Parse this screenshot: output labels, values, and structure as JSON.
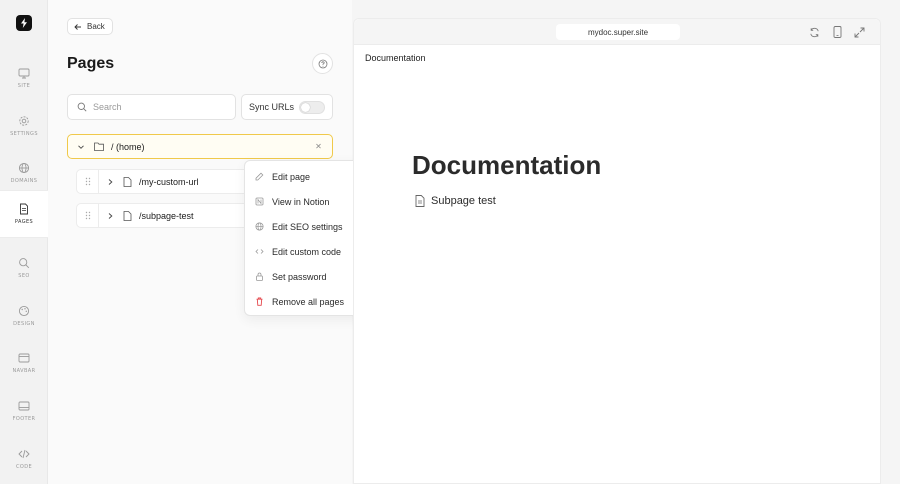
{
  "sidebar": {
    "items": [
      {
        "label": "SITE",
        "icon": "monitor-icon"
      },
      {
        "label": "SETTINGS",
        "icon": "gear-icon"
      },
      {
        "label": "DOMAINS",
        "icon": "globe-icon"
      },
      {
        "label": "PAGES",
        "icon": "page-icon"
      },
      {
        "label": "SEO",
        "icon": "search-icon"
      },
      {
        "label": "DESIGN",
        "icon": "palette-icon"
      },
      {
        "label": "NAVBAR",
        "icon": "navbar-icon"
      },
      {
        "label": "FOOTER",
        "icon": "footer-icon"
      },
      {
        "label": "CODE",
        "icon": "code-icon"
      }
    ],
    "active": "PAGES"
  },
  "main": {
    "back_label": "Back",
    "title": "Pages",
    "search_placeholder": "Search",
    "sync_label": "Sync URLs",
    "sync_enabled": false,
    "tree": {
      "home": "/ (home)",
      "children": [
        "/my-custom-url",
        "/subpage-test"
      ]
    }
  },
  "menu": {
    "items": [
      {
        "label": "Edit page",
        "icon": "edit-icon"
      },
      {
        "label": "View in Notion",
        "icon": "notion-icon"
      },
      {
        "label": "Edit SEO settings",
        "icon": "globe-icon"
      },
      {
        "label": "Edit custom code",
        "icon": "code-icon"
      },
      {
        "label": "Set password",
        "icon": "lock-icon"
      },
      {
        "label": "Remove all pages",
        "icon": "trash-icon",
        "color": "#e5484d"
      }
    ]
  },
  "preview": {
    "url": "mydoc.super.site",
    "breadcrumb": "Documentation",
    "title": "Documentation",
    "subpage": "Subpage test"
  },
  "colors": {
    "accent_border": "#f0c94a",
    "danger": "#e5484d"
  }
}
